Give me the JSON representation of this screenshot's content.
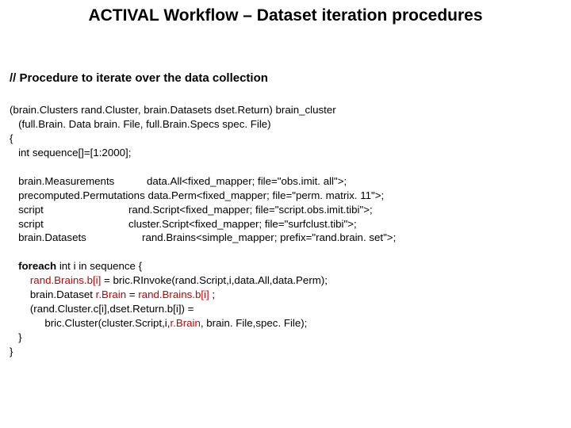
{
  "title": "ACTIVAL Workflow –  Dataset iteration procedures",
  "subtitle": "// Procedure to iterate over the data collection",
  "sig1": "(brain.Clusters rand.Cluster, brain.Datasets dset.Return) brain_cluster",
  "sig2": "   (full.Brain. Data brain. File, full.Brain.Specs spec. File)",
  "brace_open": "{",
  "seq": "   int sequence[]=[1:2000];",
  "decl_col1_l1": "   brain.Measurements",
  "decl_col1_l2": "   precomputed.Permutations",
  "decl_col1_l3": "   script",
  "decl_col1_l4": "   script",
  "decl_col1_l5": "   brain.Datasets",
  "decl_col2_l1": "data.All<fixed_mapper; file=\"obs.imit. all\">;",
  "decl_col2_l2": "data.Perm<fixed_mapper; file=\"perm. matrix. 11\">;",
  "decl_col2_l3": " rand.Script<fixed_mapper; file=\"script.obs.imit.tibi\">;",
  "decl_col2_l4": "cluster.Script<fixed_mapper; file=\"surfclust.tibi\">;",
  "decl_col2_l5": " rand.Brains<simple_mapper; prefix=\"rand.brain. set\">;",
  "foreach_kw": "foreach",
  "foreach_rest": " int i in sequence {",
  "body_l1a": "rand.Brains.b[i]",
  "body_l1b": " = bric.RInvoke(rand.Script,i,data.All,data.Perm);",
  "body_l2a": "       brain.Dataset ",
  "body_l2b": "r.Brain",
  "body_l2c": " = ",
  "body_l2d": "rand.Brains.b[i]",
  "body_l2e": " ;",
  "body_l3": "       (rand.Cluster.c[i],dset.Return.b[i]) =",
  "body_l4a": "            bric.Cluster(cluster.Script,i,",
  "body_l4b": "r.Brain",
  "body_l4c": ", brain. File,spec. File);",
  "brace_inner_close": "   }",
  "brace_close": "}"
}
